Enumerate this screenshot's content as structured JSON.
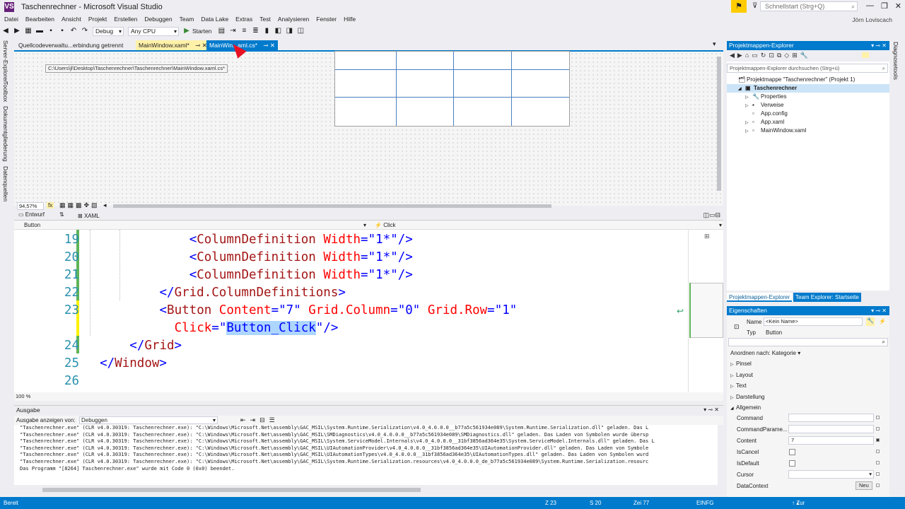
{
  "window": {
    "title": "Taschenrechner - Microsoft Visual Studio",
    "logo": "VS",
    "quick_launch_placeholder": "Schnellstart (Strg+Q)",
    "user": "Jörn Loviscach",
    "controls": [
      "—",
      "❐",
      "✕"
    ]
  },
  "menu": [
    "Datei",
    "Bearbeiten",
    "Ansicht",
    "Projekt",
    "Erstellen",
    "Debuggen",
    "Team",
    "Data Lake",
    "Extras",
    "Test",
    "Analysieren",
    "Fenster",
    "Hilfe"
  ],
  "toolbar": {
    "config": "Debug",
    "platform": "Any CPU",
    "start_label": "Starten"
  },
  "left_rail": [
    "Server-Explorer",
    "Toolbox",
    "Dokumentgliederung",
    "Datenquellen"
  ],
  "right_rail": [
    "Diagnosetools"
  ],
  "tabs": [
    {
      "label": "Quellcodeverwaltu...erbindung getrennt"
    },
    {
      "label": "MainWindow.xaml*"
    },
    {
      "label": "MainWin...aml.cs*"
    }
  ],
  "tooltip": "C:\\Users\\jl\\Desktop\\Taschenrechner\\Taschenrechner\\MainWindow.xaml.cs*",
  "designer": {
    "zoom": "94,57%",
    "fx": "fx",
    "split_tabs": [
      "Entwurf",
      "XAML"
    ]
  },
  "navbar": {
    "left": "Button",
    "right": "Click"
  },
  "code": {
    "lines": [
      {
        "num": "19",
        "indent": 7,
        "parts": [
          {
            "t": "<",
            "c": "pun"
          },
          {
            "t": "ColumnDefinition",
            "c": "tag"
          },
          {
            "t": " Width",
            "c": "attr"
          },
          {
            "t": "=\"",
            "c": "pun"
          },
          {
            "t": "1*",
            "c": "val"
          },
          {
            "t": "\"/>",
            "c": "pun"
          }
        ]
      },
      {
        "num": "20",
        "indent": 7,
        "parts": [
          {
            "t": "<",
            "c": "pun"
          },
          {
            "t": "ColumnDefinition",
            "c": "tag"
          },
          {
            "t": " Width",
            "c": "attr"
          },
          {
            "t": "=\"",
            "c": "pun"
          },
          {
            "t": "1*",
            "c": "val"
          },
          {
            "t": "\"/>",
            "c": "pun"
          }
        ]
      },
      {
        "num": "21",
        "indent": 7,
        "parts": [
          {
            "t": "<",
            "c": "pun"
          },
          {
            "t": "ColumnDefinition",
            "c": "tag"
          },
          {
            "t": " Width",
            "c": "attr"
          },
          {
            "t": "=\"",
            "c": "pun"
          },
          {
            "t": "1*",
            "c": "val"
          },
          {
            "t": "\"/>",
            "c": "pun"
          }
        ]
      },
      {
        "num": "22",
        "indent": 5,
        "parts": [
          {
            "t": "</",
            "c": "pun"
          },
          {
            "t": "Grid.ColumnDefinitions",
            "c": "tag"
          },
          {
            "t": ">",
            "c": "pun"
          }
        ]
      },
      {
        "num": "23",
        "indent": 5,
        "parts": [
          {
            "t": "<",
            "c": "pun"
          },
          {
            "t": "Button",
            "c": "tag"
          },
          {
            "t": " Content",
            "c": "attr"
          },
          {
            "t": "=\"",
            "c": "pun"
          },
          {
            "t": "7",
            "c": "val"
          },
          {
            "t": "\"",
            "c": "pun"
          },
          {
            "t": " Grid.Column",
            "c": "attr"
          },
          {
            "t": "=\"",
            "c": "pun"
          },
          {
            "t": "0",
            "c": "val"
          },
          {
            "t": "\"",
            "c": "pun"
          },
          {
            "t": " Grid.Row",
            "c": "attr"
          },
          {
            "t": "=\"",
            "c": "pun"
          },
          {
            "t": "1",
            "c": "val"
          },
          {
            "t": "\"",
            "c": "pun"
          }
        ]
      },
      {
        "num": "",
        "indent": 6,
        "parts": [
          {
            "t": "Click",
            "c": "attr"
          },
          {
            "t": "=\"",
            "c": "pun"
          },
          {
            "t": "Button_Click",
            "c": "val sel"
          },
          {
            "t": "\"/>",
            "c": "pun"
          }
        ]
      },
      {
        "num": "24",
        "indent": 3,
        "parts": [
          {
            "t": "</",
            "c": "pun"
          },
          {
            "t": "Grid",
            "c": "tag"
          },
          {
            "t": ">",
            "c": "pun"
          }
        ]
      },
      {
        "num": "25",
        "indent": 1,
        "parts": [
          {
            "t": "</",
            "c": "pun"
          },
          {
            "t": "Window",
            "c": "tag"
          },
          {
            "t": ">",
            "c": "pun"
          }
        ]
      },
      {
        "num": "26",
        "indent": 0,
        "parts": []
      }
    ],
    "zoom": "100 %"
  },
  "output": {
    "title": "Ausgabe",
    "show_label": "Ausgabe anzeigen von:",
    "source": "Debuggen",
    "lines": [
      "\"Taschenrechner.exe\" (CLR v4.0.30319: Taschenrechner.exe): \"C:\\Windows\\Microsoft.Net\\assembly\\GAC_MSIL\\System.Runtime.Serialization\\v4.0_4.0.0.0__b77a5c561934e089\\System.Runtime.Serialization.dll\" geladen. Das L",
      "\"Taschenrechner.exe\" (CLR v4.0.30319: Taschenrechner.exe): \"C:\\Windows\\Microsoft.Net\\assembly\\GAC_MSIL\\SMDiagnostics\\v4.0_4.0.0.0__b77a5c561934e089\\SMDiagnostics.dll\" geladen. Das Laden von Symbolen wurde übersp",
      "\"Taschenrechner.exe\" (CLR v4.0.30319: Taschenrechner.exe): \"C:\\Windows\\Microsoft.Net\\assembly\\GAC_MSIL\\System.ServiceModel.Internals\\v4.0_4.0.0.0__31bf3856ad364e35\\System.ServiceModel.Internals.dll\" geladen. Das L",
      "\"Taschenrechner.exe\" (CLR v4.0.30319: Taschenrechner.exe): \"C:\\Windows\\Microsoft.Net\\assembly\\GAC_MSIL\\UIAutomationProvider\\v4.0_4.0.0.0__31bf3856ad364e35\\UIAutomationProvider.dll\" geladen. Das Laden von Symbole",
      "\"Taschenrechner.exe\" (CLR v4.0.30319: Taschenrechner.exe): \"C:\\Windows\\Microsoft.Net\\assembly\\GAC_MSIL\\UIAutomationTypes\\v4.0_4.0.0.0__31bf3856ad364e35\\UIAutomationTypes.dll\" geladen. Das Laden von Symbolen wurd",
      "\"Taschenrechner.exe\" (CLR v4.0.30319: Taschenrechner.exe): \"C:\\Windows\\Microsoft.Net\\assembly\\GAC_MSIL\\System.Runtime.Serialization.resources\\v4.0_4.0.0.0_de_b77a5c561934e089\\System.Runtime.Serialization.resourc",
      "Das Programm \"[8264] Taschenrechner.exe\" wurde mit Code 0 (0x0) beendet."
    ]
  },
  "solution_explorer": {
    "title": "Projektmappen-Explorer",
    "search_placeholder": "Projektmappen-Explorer durchsuchen (Strg+ü)",
    "items": [
      {
        "label": "Projektmappe \"Taschenrechner\" (Projekt 1)",
        "level": 0,
        "arrow": "",
        "icon": "🗂"
      },
      {
        "label": "Taschenrechner",
        "level": 1,
        "arrow": "◢",
        "icon": "▣",
        "selected": true
      },
      {
        "label": "Properties",
        "level": 2,
        "arrow": "▷",
        "icon": "🔧"
      },
      {
        "label": "Verweise",
        "level": 2,
        "arrow": "▷",
        "icon": "▪"
      },
      {
        "label": "App.config",
        "level": 2,
        "arrow": "",
        "icon": "▫"
      },
      {
        "label": "App.xaml",
        "level": 2,
        "arrow": "▷",
        "icon": "▫"
      },
      {
        "label": "MainWindow.xaml",
        "level": 2,
        "arrow": "▷",
        "icon": "▫"
      }
    ],
    "tabs": [
      "Projektmappen-Explorer",
      "Team Explorer: Startseite"
    ]
  },
  "properties": {
    "title": "Eigenschaften",
    "name_label": "Name",
    "name_value": "<Kein Name>",
    "type_label": "Typ",
    "type_value": "Button",
    "arrange_label": "Anordnen nach: Kategorie",
    "categories": [
      "Pinsel",
      "Layout",
      "Text",
      "Darstellung",
      "Allgemein"
    ],
    "rows": [
      {
        "label": "Command",
        "kind": "text",
        "value": ""
      },
      {
        "label": "CommandParame...",
        "kind": "text",
        "value": ""
      },
      {
        "label": "Content",
        "kind": "text",
        "value": "7"
      },
      {
        "label": "IsCancel",
        "kind": "check",
        "value": ""
      },
      {
        "label": "IsDefault",
        "kind": "check",
        "value": ""
      },
      {
        "label": "Cursor",
        "kind": "combo",
        "value": ""
      },
      {
        "label": "DataContext",
        "kind": "button",
        "value": "Neu"
      }
    ]
  },
  "status": {
    "ready": "Bereit",
    "line": "Z 23",
    "col": "S 20",
    "char": "Zei 77",
    "mode": "EINFG",
    "scc": "Zur Quellcodeverwaltung hinzufügen"
  }
}
